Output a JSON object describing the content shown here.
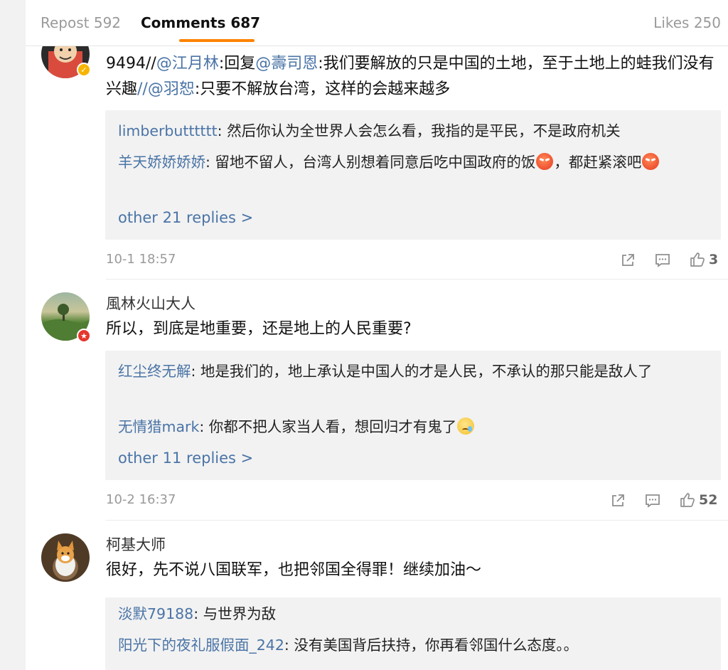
{
  "tabs": {
    "repost": "Repost 592",
    "comments": "Comments 687",
    "likes": "Likes 250"
  },
  "comments": [
    {
      "author": "",
      "text_parts": [
        {
          "t": "9494//",
          "mention": false
        },
        {
          "t": "@江月林",
          "mention": true
        },
        {
          "t": ":回复",
          "mention": false
        },
        {
          "t": "@壽司恩",
          "mention": true
        },
        {
          "t": ":我们要解放的只是中国的土地，至于土地上的蛙我们没有兴趣",
          "mention": false
        },
        {
          "t": "//@羽恕",
          "mention": true
        },
        {
          "t": ":只要不解放台湾，这样的会越来越多",
          "mention": false
        }
      ],
      "replies": [
        {
          "name": "limberbutttttt",
          "text": ": 然后你认为全世界人会怎么看，我指的是平民，不是政府机关"
        },
        {
          "name": "羊天娇娇娇娇",
          "text": ": 留地不留人，台湾人别想着同意后吃中国政府的饭"
        }
      ],
      "reply2_mid": "，都赶紧滚吧",
      "more": "other 21 replies >",
      "time": "10-1 18:57",
      "likes": "3"
    },
    {
      "author": "風林火山大人",
      "text": "所以，到底是地重要，还是地上的人民重要?",
      "replies": [
        {
          "name": "红尘终无解",
          "text": ": 地是我们的，地上承认是中国人的才是人民，不承认的那只能是敌人了"
        },
        {
          "name": "无情猎mark",
          "text": ": 你都不把人家当人看，想回归才有鬼了"
        }
      ],
      "more": "other 11 replies >",
      "time": "10-2 16:37",
      "likes": "52"
    },
    {
      "author": "柯基大师",
      "text": "很好，先不说八国联军，也把邻国全得罪！继续加油～",
      "replies": [
        {
          "name": "淡默79188",
          "text": ": 与世界为敌"
        },
        {
          "name": "阳光下的夜礼服假面_242",
          "text": ": 没有美国背后扶持，你再看邻国什么态度。。"
        }
      ]
    }
  ],
  "icons": {
    "share": "share-icon",
    "comment": "comment-icon",
    "like": "thumbs-up-icon",
    "emoji_angry": "angry-emoji-icon",
    "emoji_sad": "sad-tear-emoji-icon"
  },
  "colors": {
    "accent": "#ff8200",
    "link": "#4a74a6",
    "muted": "#9a9a9a",
    "reply_bg": "#f2f2f2"
  }
}
